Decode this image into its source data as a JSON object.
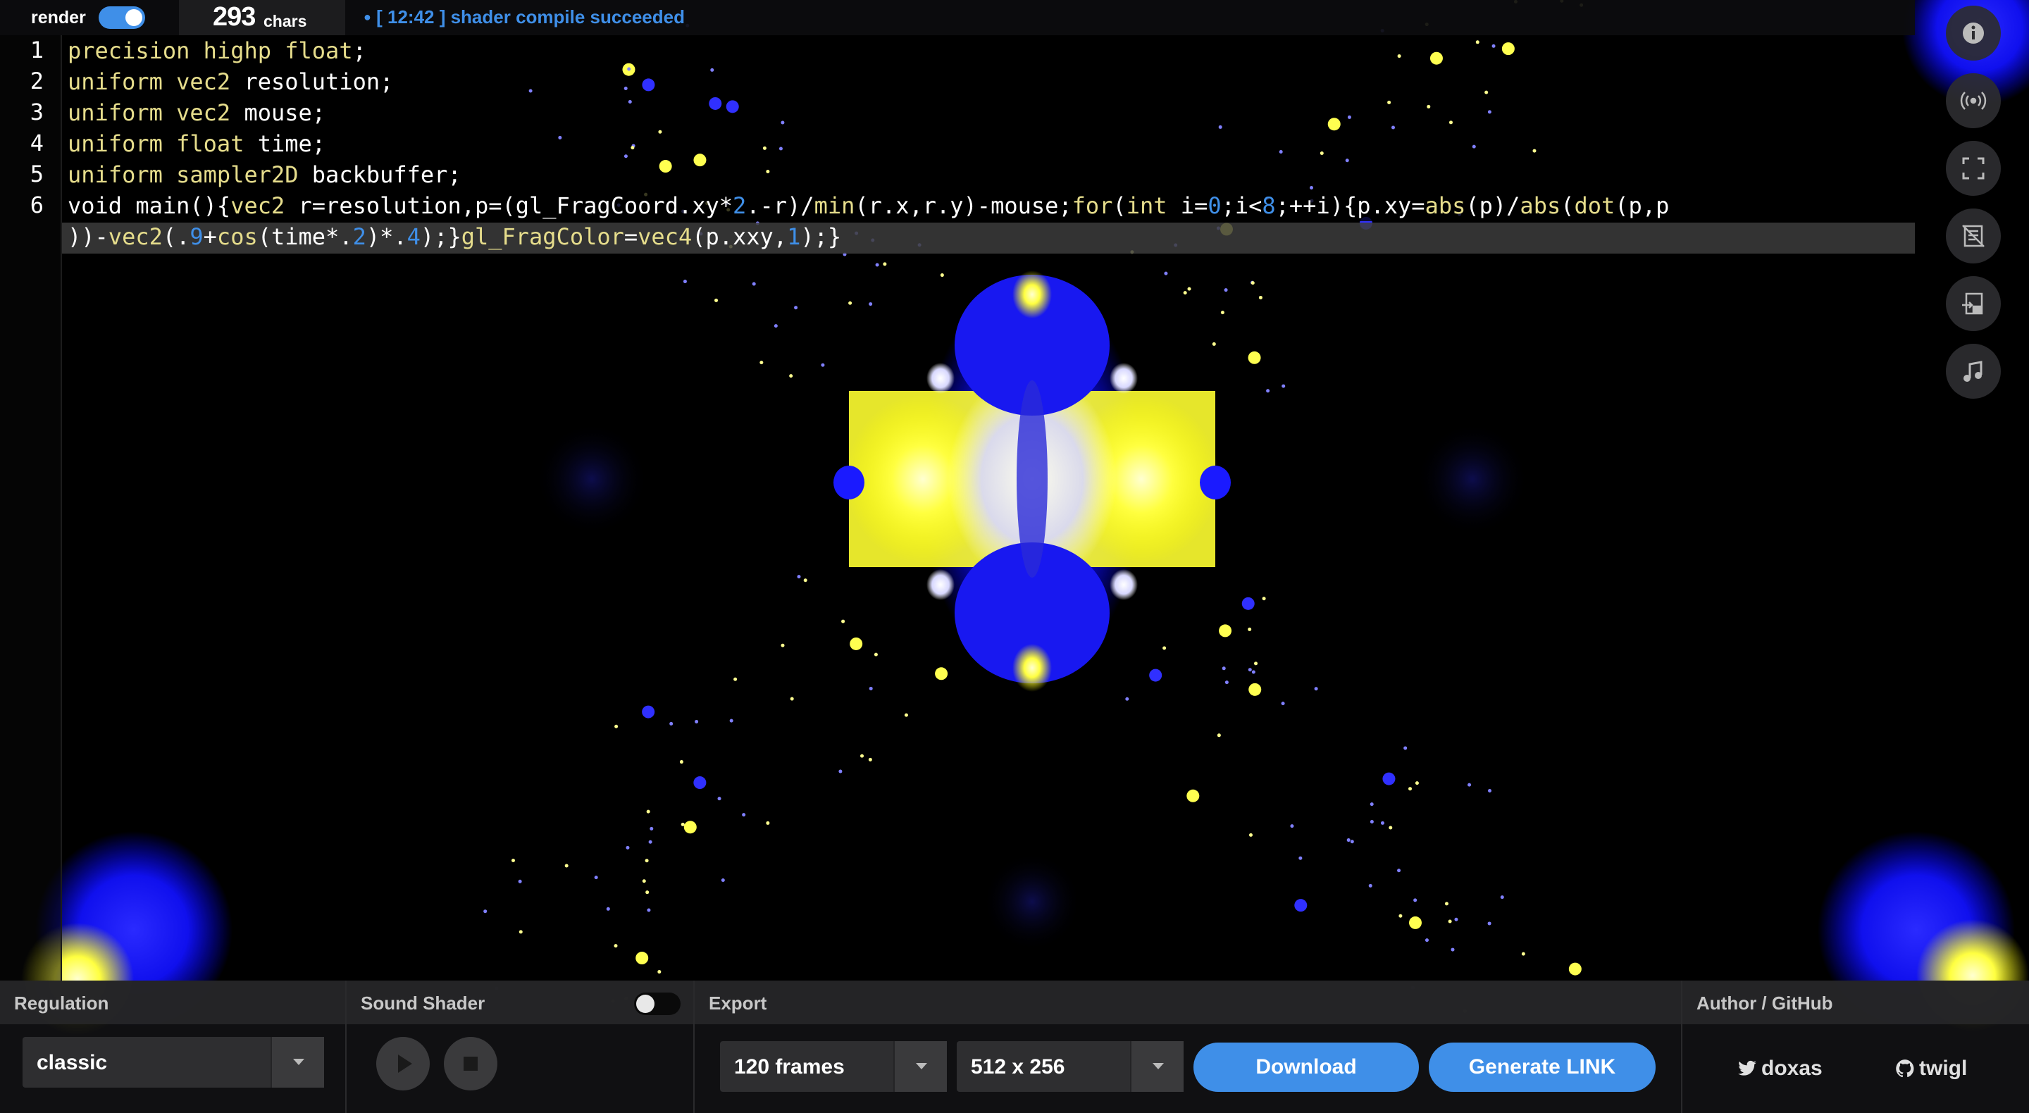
{
  "topbar": {
    "render_label": "render",
    "render_enabled": true,
    "char_count": "293",
    "char_unit": "chars",
    "status_dot": "●",
    "status_text": "[ 12:42 ] shader compile succeeded"
  },
  "editor": {
    "line_numbers": [
      "1",
      "2",
      "3",
      "4",
      "5",
      "6"
    ],
    "lines": [
      "precision highp float;",
      "uniform vec2 resolution;",
      "uniform vec2 mouse;",
      "uniform float time;",
      "uniform sampler2D backbuffer;",
      "void main(){vec2 r=resolution,p=(gl_FragCoord.xy*2.-r)/min(r.x,r.y)-mouse;for(int i=0;i<8;++i){p.xy=abs(p)/abs(dot(p,p",
      "))-vec2(.9+cos(time*.2)*.4);}gl_FragColor=vec4(p.xxy,1);}"
    ]
  },
  "sidebar": {
    "buttons": [
      "info-icon",
      "broadcast-icon",
      "fullscreen-icon",
      "hide-editor-icon",
      "sync-scroll-icon",
      "music-note-icon"
    ]
  },
  "bottom": {
    "regulation": {
      "title": "Regulation",
      "mode": "classic"
    },
    "sound_shader": {
      "title": "Sound Shader",
      "enabled": false
    },
    "export": {
      "title": "Export",
      "frames": "120 frames",
      "size": "512 x 256",
      "download_label": "Download",
      "link_label": "Generate LINK"
    },
    "author": {
      "title": "Author / GitHub",
      "author_name": "doxas",
      "repo_name": "twigl"
    }
  },
  "colors": {
    "accent": "#3f8fe8",
    "keyword": "#e6dd8c",
    "shader_blue": "#1010ff",
    "shader_yellow": "#ffff30"
  }
}
